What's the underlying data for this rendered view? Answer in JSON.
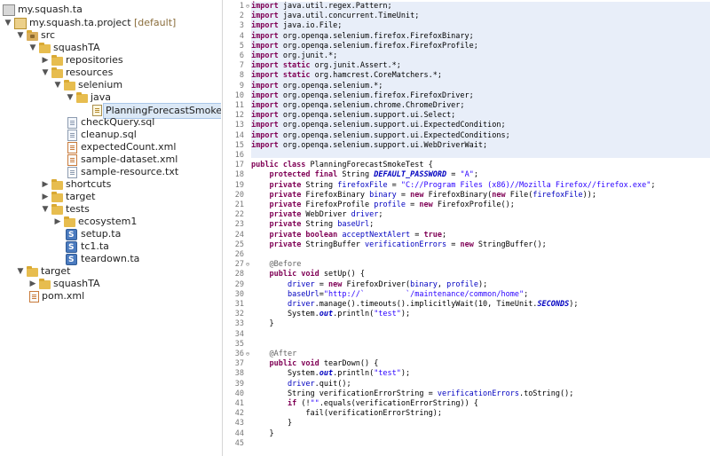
{
  "explorer": {
    "items": [
      {
        "label": "my.squash.ta",
        "decor": ""
      },
      {
        "label": "my.squash.ta.project",
        "decor": "[default]"
      },
      {
        "label": "src",
        "decor": ""
      },
      {
        "label": "squashTA",
        "decor": ""
      },
      {
        "label": "repositories",
        "decor": ""
      },
      {
        "label": "resources",
        "decor": ""
      },
      {
        "label": "selenium",
        "decor": ""
      },
      {
        "label": "java",
        "decor": ""
      },
      {
        "label": "PlanningForecastSmokeTest.java",
        "decor": ""
      },
      {
        "label": "checkQuery.sql",
        "decor": ""
      },
      {
        "label": "cleanup.sql",
        "decor": ""
      },
      {
        "label": "expectedCount.xml",
        "decor": ""
      },
      {
        "label": "sample-dataset.xml",
        "decor": ""
      },
      {
        "label": "sample-resource.txt",
        "decor": ""
      },
      {
        "label": "shortcuts",
        "decor": ""
      },
      {
        "label": "target",
        "decor": ""
      },
      {
        "label": "tests",
        "decor": ""
      },
      {
        "label": "ecosystem1",
        "decor": ""
      },
      {
        "label": "setup.ta",
        "decor": ""
      },
      {
        "label": "tc1.ta",
        "decor": ""
      },
      {
        "label": "teardown.ta",
        "decor": ""
      },
      {
        "label": "target",
        "decor": ""
      },
      {
        "label": "squashTA",
        "decor": ""
      },
      {
        "label": "pom.xml",
        "decor": ""
      }
    ]
  },
  "editor": {
    "line_numbers": [
      "1",
      "2",
      "3",
      "4",
      "5",
      "6",
      "7",
      "8",
      "9",
      "10",
      "11",
      "12",
      "13",
      "14",
      "15",
      "16",
      "17",
      "18",
      "19",
      "20",
      "21",
      "22",
      "23",
      "24",
      "25",
      "26",
      "27",
      "28",
      "29",
      "30",
      "31",
      "32",
      "33",
      "34",
      "35",
      "36",
      "37",
      "38",
      "39",
      "40",
      "41",
      "42",
      "43",
      "44",
      "45"
    ],
    "fold_markers": {
      "1": "⊖",
      "27": "⊖",
      "36": "⊖"
    },
    "lines": [
      [
        {
          "t": "import",
          "s": "kw"
        },
        {
          "t": " java.util.regex.Pattern;",
          "s": ""
        }
      ],
      [
        {
          "t": "import",
          "s": "kw"
        },
        {
          "t": " java.util.concurrent.TimeUnit;",
          "s": ""
        }
      ],
      [
        {
          "t": "import",
          "s": "kw"
        },
        {
          "t": " java.io.File;",
          "s": ""
        }
      ],
      [
        {
          "t": "import",
          "s": "kw"
        },
        {
          "t": " org.openqa.selenium.firefox.FirefoxBinary;",
          "s": ""
        }
      ],
      [
        {
          "t": "import",
          "s": "kw"
        },
        {
          "t": " org.openqa.selenium.firefox.FirefoxProfile;",
          "s": ""
        }
      ],
      [
        {
          "t": "import",
          "s": "kw"
        },
        {
          "t": " org.junit.*;",
          "s": ""
        }
      ],
      [
        {
          "t": "import static",
          "s": "kw"
        },
        {
          "t": " org.junit.Assert.*;",
          "s": ""
        }
      ],
      [
        {
          "t": "import static",
          "s": "kw"
        },
        {
          "t": " org.hamcrest.CoreMatchers.*;",
          "s": ""
        }
      ],
      [
        {
          "t": "import",
          "s": "kw"
        },
        {
          "t": " org.openqa.selenium.*;",
          "s": ""
        }
      ],
      [
        {
          "t": "import",
          "s": "kw"
        },
        {
          "t": " org.openqa.selenium.firefox.FirefoxDriver;",
          "s": ""
        }
      ],
      [
        {
          "t": "import",
          "s": "kw"
        },
        {
          "t": " org.openqa.selenium.chrome.ChromeDriver;",
          "s": ""
        }
      ],
      [
        {
          "t": "import",
          "s": "kw"
        },
        {
          "t": " org.openqa.selenium.support.ui.Select;",
          "s": ""
        }
      ],
      [
        {
          "t": "import",
          "s": "kw"
        },
        {
          "t": " org.openqa.selenium.support.ui.ExpectedCondition;",
          "s": ""
        }
      ],
      [
        {
          "t": "import",
          "s": "kw"
        },
        {
          "t": " org.openqa.selenium.support.ui.ExpectedConditions;",
          "s": ""
        }
      ],
      [
        {
          "t": "import",
          "s": "kw"
        },
        {
          "t": " org.openqa.selenium.support.ui.WebDriverWait;",
          "s": ""
        }
      ],
      [],
      [
        {
          "t": "public class",
          "s": "kw"
        },
        {
          "t": " PlanningForecastSmokeTest {",
          "s": ""
        }
      ],
      [
        {
          "t": "    ",
          "s": ""
        },
        {
          "t": "protected final",
          "s": "kw"
        },
        {
          "t": " String ",
          "s": ""
        },
        {
          "t": "DEFAULT_PASSWORD",
          "s": "fld-b"
        },
        {
          "t": " = ",
          "s": ""
        },
        {
          "t": "\"A\"",
          "s": "str"
        },
        {
          "t": ";",
          "s": ""
        }
      ],
      [
        {
          "t": "    ",
          "s": ""
        },
        {
          "t": "private",
          "s": "kw"
        },
        {
          "t": " String ",
          "s": ""
        },
        {
          "t": "firefoxFile",
          "s": "fld"
        },
        {
          "t": " = ",
          "s": ""
        },
        {
          "t": "\"C://Program Files (x86)//Mozilla Firefox//firefox.exe\"",
          "s": "str"
        },
        {
          "t": ";",
          "s": ""
        }
      ],
      [
        {
          "t": "    ",
          "s": ""
        },
        {
          "t": "private",
          "s": "kw"
        },
        {
          "t": " FirefoxBinary ",
          "s": ""
        },
        {
          "t": "binary",
          "s": "fld"
        },
        {
          "t": " = ",
          "s": ""
        },
        {
          "t": "new",
          "s": "kw"
        },
        {
          "t": " FirefoxBinary(",
          "s": ""
        },
        {
          "t": "new",
          "s": "kw"
        },
        {
          "t": " File(",
          "s": ""
        },
        {
          "t": "firefoxFile",
          "s": "fld"
        },
        {
          "t": "));",
          "s": ""
        }
      ],
      [
        {
          "t": "    ",
          "s": ""
        },
        {
          "t": "private",
          "s": "kw"
        },
        {
          "t": " FirefoxProfile ",
          "s": ""
        },
        {
          "t": "profile",
          "s": "fld"
        },
        {
          "t": " = ",
          "s": ""
        },
        {
          "t": "new",
          "s": "kw"
        },
        {
          "t": " FirefoxProfile();",
          "s": ""
        }
      ],
      [
        {
          "t": "    ",
          "s": ""
        },
        {
          "t": "private",
          "s": "kw"
        },
        {
          "t": " WebDriver ",
          "s": ""
        },
        {
          "t": "driver",
          "s": "fld"
        },
        {
          "t": ";",
          "s": ""
        }
      ],
      [
        {
          "t": "    ",
          "s": ""
        },
        {
          "t": "private",
          "s": "kw"
        },
        {
          "t": " String ",
          "s": ""
        },
        {
          "t": "baseUrl",
          "s": "fld"
        },
        {
          "t": ";",
          "s": ""
        }
      ],
      [
        {
          "t": "    ",
          "s": ""
        },
        {
          "t": "private boolean",
          "s": "kw"
        },
        {
          "t": " ",
          "s": ""
        },
        {
          "t": "acceptNextAlert",
          "s": "fld"
        },
        {
          "t": " = ",
          "s": ""
        },
        {
          "t": "true",
          "s": "kw"
        },
        {
          "t": ";",
          "s": ""
        }
      ],
      [
        {
          "t": "    ",
          "s": ""
        },
        {
          "t": "private",
          "s": "kw"
        },
        {
          "t": " StringBuffer ",
          "s": ""
        },
        {
          "t": "verificationErrors",
          "s": "fld"
        },
        {
          "t": " = ",
          "s": ""
        },
        {
          "t": "new",
          "s": "kw"
        },
        {
          "t": " StringBuffer();",
          "s": ""
        }
      ],
      [],
      [
        {
          "t": "    ",
          "s": ""
        },
        {
          "t": "@Before",
          "s": "ann"
        }
      ],
      [
        {
          "t": "    ",
          "s": ""
        },
        {
          "t": "public void",
          "s": "kw"
        },
        {
          "t": " setUp() {",
          "s": ""
        }
      ],
      [
        {
          "t": "        ",
          "s": ""
        },
        {
          "t": "driver",
          "s": "fld"
        },
        {
          "t": " = ",
          "s": ""
        },
        {
          "t": "new",
          "s": "kw"
        },
        {
          "t": " FirefoxDriver(",
          "s": ""
        },
        {
          "t": "binary",
          "s": "fld"
        },
        {
          "t": ", ",
          "s": ""
        },
        {
          "t": "profile",
          "s": "fld"
        },
        {
          "t": ");",
          "s": ""
        }
      ],
      [
        {
          "t": "        ",
          "s": ""
        },
        {
          "t": "baseUrl",
          "s": "fld"
        },
        {
          "t": "=",
          "s": ""
        },
        {
          "t": "\"http://`         `/maintenance/common/home\"",
          "s": "str"
        },
        {
          "t": ";",
          "s": ""
        }
      ],
      [
        {
          "t": "        ",
          "s": ""
        },
        {
          "t": "driver",
          "s": "fld"
        },
        {
          "t": ".manage().timeouts().implicitlyWait(10, TimeUnit.",
          "s": ""
        },
        {
          "t": "SECONDS",
          "s": "fld-b"
        },
        {
          "t": ");",
          "s": ""
        }
      ],
      [
        {
          "t": "        System.",
          "s": ""
        },
        {
          "t": "out",
          "s": "fld-b"
        },
        {
          "t": ".println(",
          "s": ""
        },
        {
          "t": "\"test\"",
          "s": "str"
        },
        {
          "t": ");",
          "s": ""
        }
      ],
      [
        {
          "t": "    }",
          "s": ""
        }
      ],
      [],
      [],
      [
        {
          "t": "    ",
          "s": ""
        },
        {
          "t": "@After",
          "s": "ann"
        }
      ],
      [
        {
          "t": "    ",
          "s": ""
        },
        {
          "t": "public void",
          "s": "kw"
        },
        {
          "t": " tearDown() {",
          "s": ""
        }
      ],
      [
        {
          "t": "        System.",
          "s": ""
        },
        {
          "t": "out",
          "s": "fld-b"
        },
        {
          "t": ".println(",
          "s": ""
        },
        {
          "t": "\"test\"",
          "s": "str"
        },
        {
          "t": ");",
          "s": ""
        }
      ],
      [
        {
          "t": "        ",
          "s": ""
        },
        {
          "t": "driver",
          "s": "fld"
        },
        {
          "t": ".quit();",
          "s": ""
        }
      ],
      [
        {
          "t": "        String verificationErrorString = ",
          "s": ""
        },
        {
          "t": "verificationErrors",
          "s": "fld"
        },
        {
          "t": ".toString();",
          "s": ""
        }
      ],
      [
        {
          "t": "        ",
          "s": ""
        },
        {
          "t": "if",
          "s": "kw"
        },
        {
          "t": " (!",
          "s": ""
        },
        {
          "t": "\"\"",
          "s": "str"
        },
        {
          "t": ".equals(verificationErrorString)) {",
          "s": ""
        }
      ],
      [
        {
          "t": "            fail(verificationErrorString);",
          "s": ""
        }
      ],
      [
        {
          "t": "        }",
          "s": ""
        }
      ],
      [
        {
          "t": "    }",
          "s": ""
        }
      ],
      []
    ]
  }
}
